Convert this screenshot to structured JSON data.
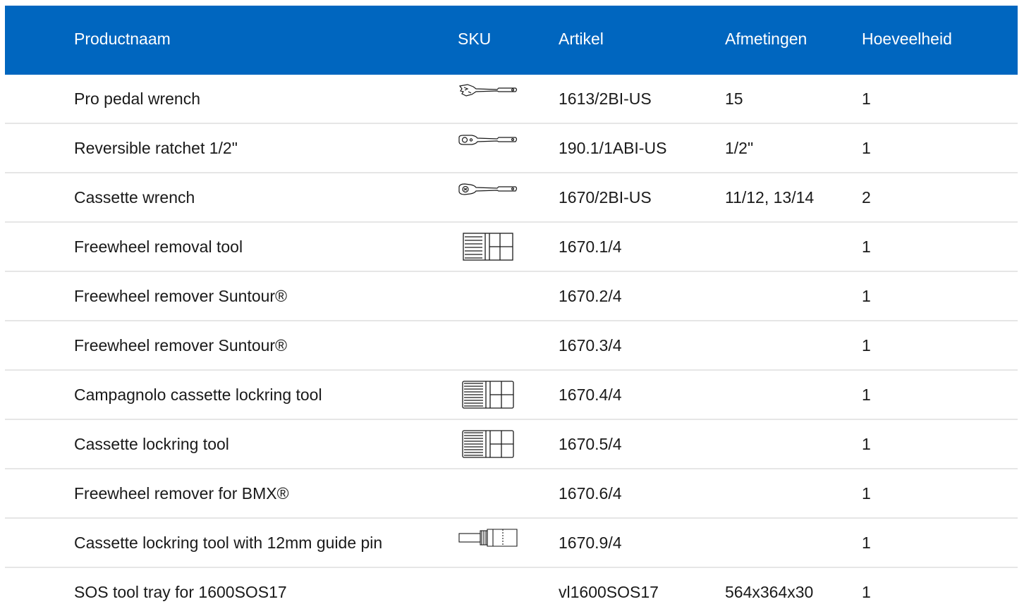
{
  "header": {
    "name": "Productnaam",
    "sku": "SKU",
    "article": "Artikel",
    "dimensions": "Afmetingen",
    "quantity": "Hoeveelheid"
  },
  "colors": {
    "header_bg": "#0066bf",
    "header_text": "#ffffff",
    "row_divider": "#e6e6e6"
  },
  "rows": [
    {
      "name": "Pro pedal wrench",
      "icon": "pedal-wrench-icon",
      "article": "1613/2BI-US",
      "dimensions": "15",
      "quantity": "1"
    },
    {
      "name": "Reversible ratchet 1/2\"",
      "icon": "ratchet-icon",
      "article": "190.1/1ABI-US",
      "dimensions": "1/2\"",
      "quantity": "1"
    },
    {
      "name": "Cassette wrench",
      "icon": "cassette-wrench-icon",
      "article": "1670/2BI-US",
      "dimensions": "11/12, 13/14",
      "quantity": "2"
    },
    {
      "name": "Freewheel removal tool",
      "icon": "freewheel-tool-icon",
      "article": "1670.1/4",
      "dimensions": "",
      "quantity": "1"
    },
    {
      "name": "Freewheel remover Suntour®",
      "icon": "",
      "article": "1670.2/4",
      "dimensions": "",
      "quantity": "1"
    },
    {
      "name": "Freewheel remover Suntour®",
      "icon": "",
      "article": "1670.3/4",
      "dimensions": "",
      "quantity": "1"
    },
    {
      "name": "Campagnolo cassette lockring tool",
      "icon": "lockring-tool-icon",
      "article": "1670.4/4",
      "dimensions": "",
      "quantity": "1"
    },
    {
      "name": "Cassette lockring tool",
      "icon": "lockring-tool-icon",
      "article": "1670.5/4",
      "dimensions": "",
      "quantity": "1"
    },
    {
      "name": "Freewheel remover for BMX®",
      "icon": "",
      "article": "1670.6/4",
      "dimensions": "",
      "quantity": "1"
    },
    {
      "name": "Cassette lockring tool with 12mm guide pin",
      "icon": "guide-pin-tool-icon",
      "article": "1670.9/4",
      "dimensions": "",
      "quantity": "1"
    },
    {
      "name": "SOS tool tray for 1600SOS17",
      "icon": "",
      "article": "vl1600SOS17",
      "dimensions": "564x364x30",
      "quantity": "1"
    }
  ]
}
